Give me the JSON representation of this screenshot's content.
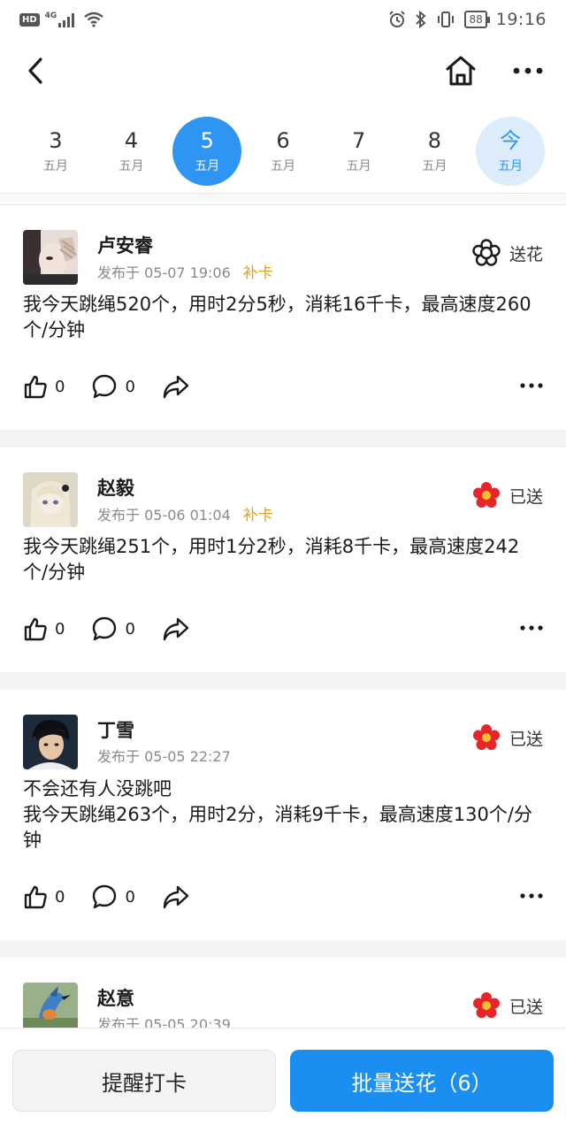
{
  "status_bar": {
    "hd": "HD",
    "network": "4G",
    "battery": "88",
    "time": "19:16"
  },
  "dates": [
    {
      "day": "3",
      "month": "五月",
      "state": "normal"
    },
    {
      "day": "4",
      "month": "五月",
      "state": "normal"
    },
    {
      "day": "5",
      "month": "五月",
      "state": "selected"
    },
    {
      "day": "6",
      "month": "五月",
      "state": "normal"
    },
    {
      "day": "7",
      "month": "五月",
      "state": "normal"
    },
    {
      "day": "8",
      "month": "五月",
      "state": "normal"
    },
    {
      "day": "今",
      "month": "五月",
      "state": "today"
    }
  ],
  "posts": [
    {
      "name": "卢安睿",
      "time": "发布于 05-07 19:06",
      "tag": "补卡",
      "flower_label": "送花",
      "flower_sent": false,
      "text": "我今天跳绳520个，用时2分5秒，消耗16千卡，最高速度260个/分钟",
      "likes": "0",
      "comments": "0"
    },
    {
      "name": "赵毅",
      "time": "发布于 05-06 01:04",
      "tag": "补卡",
      "flower_label": "已送",
      "flower_sent": true,
      "text": "我今天跳绳251个，用时1分2秒，消耗8千卡，最高速度242个/分钟",
      "likes": "0",
      "comments": "0"
    },
    {
      "name": "丁雪",
      "time": "发布于 05-05 22:27",
      "tag": "",
      "flower_label": "已送",
      "flower_sent": true,
      "text": "不会还有人没跳吧\n我今天跳绳263个，用时2分，消耗9千卡，最高速度130个/分钟",
      "likes": "0",
      "comments": "0"
    },
    {
      "name": "赵意",
      "time": "发布于 05-05 20:39",
      "tag": "",
      "flower_label": "已送",
      "flower_sent": true,
      "text": "",
      "likes": "",
      "comments": ""
    }
  ],
  "bottom": {
    "remind_label": "提醒打卡",
    "batch_label": "批量送花（6）"
  },
  "colors": {
    "accent": "#2f95f2",
    "makeup_tag": "#e0a21d",
    "flower_red": "#e8262a"
  }
}
